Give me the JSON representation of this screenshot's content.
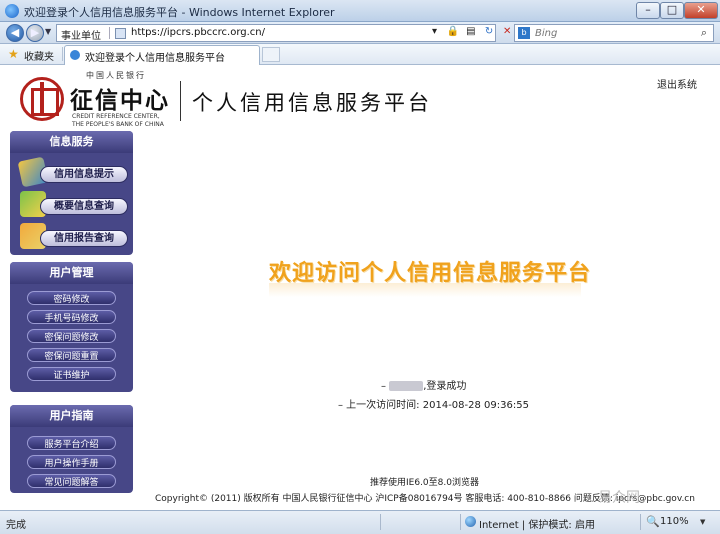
{
  "browser": {
    "window_title": "欢迎登录个人信用信息服务平台 - Windows Internet Explorer",
    "company_label": "事业单位",
    "url": "https://ipcrs.pbccrc.org.cn/",
    "search_placeholder": "Bing",
    "favorites_label": "收藏夹",
    "tab_label": "欢迎登录个人信用信息服务平台",
    "status_text": "完成",
    "zone_text": "Internet | 保护模式: 启用",
    "zoom": "110%"
  },
  "header": {
    "logo_top": "中国人民银行",
    "logo_name": "征信中心",
    "logo_en_line1": "CREDIT REFERENCE CENTER,",
    "logo_en_line2": "THE PEOPLE'S BANK OF CHINA",
    "platform_title": "个人信用信息服务平台",
    "logout": "退出系统"
  },
  "sidebar": {
    "info_services": {
      "title": "信息服务",
      "items": [
        "信用信息提示",
        "概要信息查询",
        "信用报告查询"
      ]
    },
    "user_management": {
      "title": "用户管理",
      "items": [
        "密码修改",
        "手机号码修改",
        "密保问题修改",
        "密保问题重置",
        "证书维护"
      ]
    },
    "user_guide": {
      "title": "用户指南",
      "items": [
        "服务平台介绍",
        "用户操作手册",
        "常见问题解答"
      ]
    }
  },
  "main": {
    "welcome": "欢迎访问个人信用信息服务平台",
    "login_prefix": "–",
    "login_success": ",登录成功",
    "last_visit_label": "– 上一次访问时间:",
    "last_visit_time": "2014-08-28 09:36:55",
    "browser_recommend": "推荐使用IE6.0至8.0浏览器",
    "copyright": "Copyright© (2011) 版权所有 中国人民银行征信中心 沪ICP备08016794号 客服电话: 400-810-8866 问题反馈:",
    "feedback_email": "ipcrs@pbc.gov.cn",
    "watermark": "易众网"
  },
  "colors": {
    "sidebar_panel": "#474787",
    "welcome_orange": "#f0a21d",
    "logo_red": "#b3211c"
  }
}
